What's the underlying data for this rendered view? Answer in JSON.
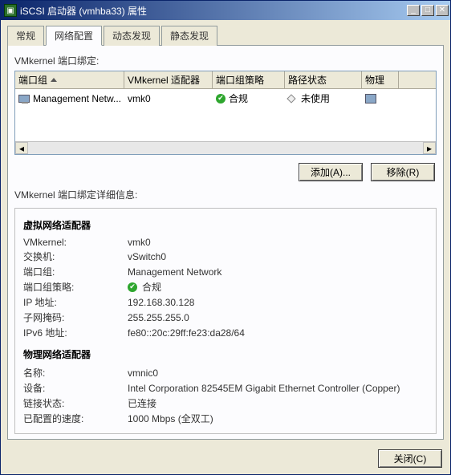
{
  "window": {
    "title": "iSCSI 启动器 (vmhba33) 属性"
  },
  "tabs": {
    "items": [
      {
        "label": "常规"
      },
      {
        "label": "网络配置"
      },
      {
        "label": "动态发现"
      },
      {
        "label": "静态发现"
      }
    ],
    "activeIndex": 1
  },
  "bindingSectionLabel": "VMkernel 端口绑定:",
  "grid": {
    "headers": {
      "portGroup": "端口组",
      "adapter": "VMkernel 适配器",
      "policy": "端口组策略",
      "pathStatus": "路径状态",
      "physical": "物理"
    },
    "rows": [
      {
        "portGroup": "Management Netw...",
        "adapter": "vmk0",
        "policy": "合规",
        "pathStatus": "未使用"
      }
    ]
  },
  "buttons": {
    "add": "添加(A)...",
    "remove": "移除(R)",
    "close": "关闭(C)"
  },
  "detailsLabel": "VMkernel 端口绑定详细信息:",
  "details": {
    "virtualHeader": "虚拟网络适配器",
    "physicalHeader": "物理网络适配器",
    "virtual": {
      "vmkernelLabel": "VMkernel:",
      "vmkernelValue": "vmk0",
      "switchLabel": "交换机:",
      "switchValue": "vSwitch0",
      "portGroupLabel": "端口组:",
      "portGroupValue": "Management Network",
      "policyLabel": "端口组策略:",
      "policyValue": "合规",
      "ipLabel": "IP 地址:",
      "ipValue": "192.168.30.128",
      "netmaskLabel": "子网掩码:",
      "netmaskValue": "255.255.255.0",
      "ipv6Label": "IPv6 地址:",
      "ipv6Value": "fe80::20c:29ff:fe23:da28/64"
    },
    "physical": {
      "nameLabel": "名称:",
      "nameValue": "vmnic0",
      "deviceLabel": "设备:",
      "deviceValue": "Intel Corporation 82545EM Gigabit Ethernet Controller (Copper)",
      "linkLabel": "链接状态:",
      "linkValue": "已连接",
      "speedLabel": "已配置的速度:",
      "speedValue": "1000 Mbps (全双工)"
    }
  }
}
